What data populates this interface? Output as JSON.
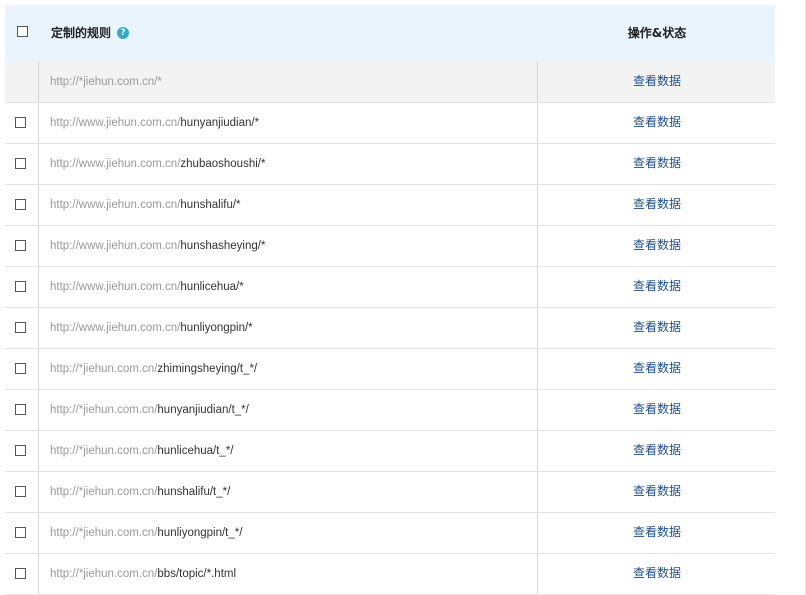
{
  "header": {
    "rule_label": "定制的规则",
    "help_glyph": "?",
    "op_label": "操作&状态"
  },
  "rows": [
    {
      "prefix": "http://*jiehun.com.cn/*",
      "suffix": "",
      "action": "查看数据",
      "has_checkbox": false
    },
    {
      "prefix": "http://www.jiehun.com.cn/",
      "suffix": "hunyanjiudian/*",
      "action": "查看数据",
      "has_checkbox": true
    },
    {
      "prefix": "http://www.jiehun.com.cn/",
      "suffix": "zhubaoshoushi/*",
      "action": "查看数据",
      "has_checkbox": true
    },
    {
      "prefix": "http://www.jiehun.com.cn/",
      "suffix": "hunshalifu/*",
      "action": "查看数据",
      "has_checkbox": true
    },
    {
      "prefix": "http://www.jiehun.com.cn/",
      "suffix": "hunshasheying/*",
      "action": "查看数据",
      "has_checkbox": true
    },
    {
      "prefix": "http://www.jiehun.com.cn/",
      "suffix": "hunlicehua/*",
      "action": "查看数据",
      "has_checkbox": true
    },
    {
      "prefix": "http://www.jiehun.com.cn/",
      "suffix": "hunliyongpin/*",
      "action": "查看数据",
      "has_checkbox": true
    },
    {
      "prefix": "http://*jiehun.com.cn/",
      "suffix": "zhimingsheying/t_*/",
      "action": "查看数据",
      "has_checkbox": true
    },
    {
      "prefix": "http://*jiehun.com.cn/",
      "suffix": "hunyanjiudian/t_*/",
      "action": "查看数据",
      "has_checkbox": true
    },
    {
      "prefix": "http://*jiehun.com.cn/",
      "suffix": "hunlicehua/t_*/",
      "action": "查看数据",
      "has_checkbox": true
    },
    {
      "prefix": "http://*jiehun.com.cn/",
      "suffix": "hunshalifu/t_*/",
      "action": "查看数据",
      "has_checkbox": true
    },
    {
      "prefix": "http://*jiehun.com.cn/",
      "suffix": "hunliyongpin/t_*/",
      "action": "查看数据",
      "has_checkbox": true
    },
    {
      "prefix": "http://*jiehun.com.cn/",
      "suffix": "bbs/topic/*.html",
      "action": "查看数据",
      "has_checkbox": true
    }
  ]
}
